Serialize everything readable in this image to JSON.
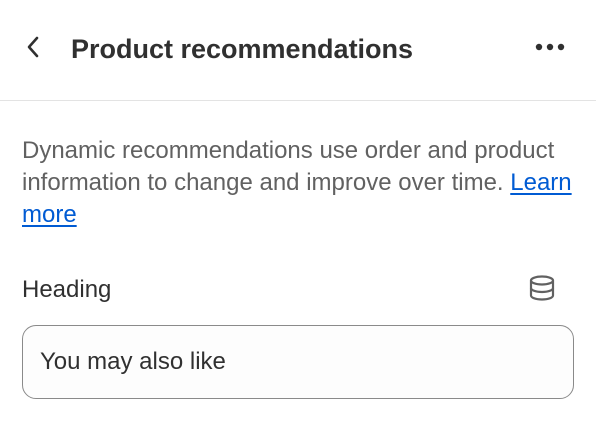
{
  "header": {
    "title": "Product recommendations",
    "back_icon": "chevron-left-icon",
    "more_icon": "more-horizontal-icon"
  },
  "description": {
    "text": "Dynamic recommendations use order and product information to change and improve over time. ",
    "link_label": "Learn more"
  },
  "heading_field": {
    "label": "Heading",
    "value": "You may also like",
    "dynamic_source_icon": "database-icon"
  },
  "colors": {
    "link": "#005bd3",
    "text_primary": "#303030",
    "text_secondary": "#616161",
    "border": "#8a8a8a",
    "divider": "#e3e3e3"
  }
}
